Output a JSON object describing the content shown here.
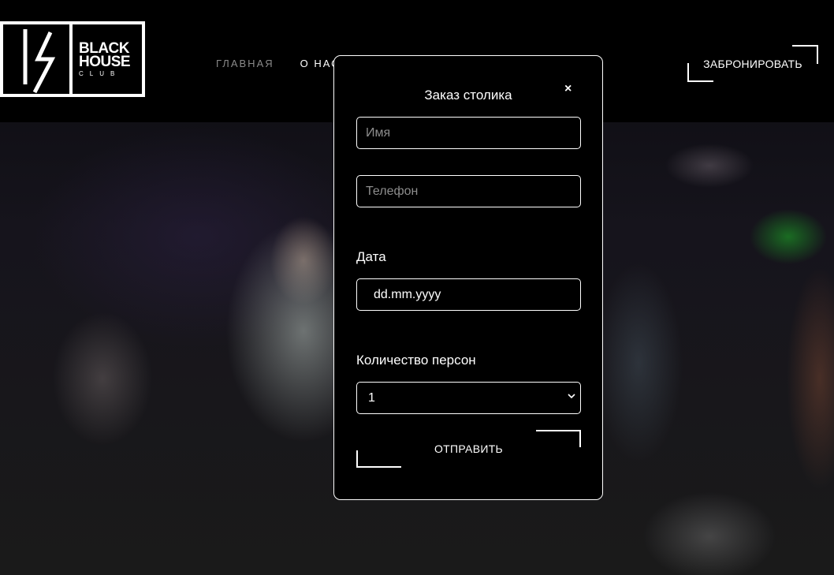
{
  "header": {
    "logo": {
      "line1": "BLACK",
      "line2": "HOUSE",
      "line3": "CLUB"
    },
    "nav": [
      {
        "label": "ГЛАВНАЯ",
        "active": false
      },
      {
        "label": "О НАС",
        "active": true
      }
    ],
    "book_button": "ЗАБРОНИРОВАТЬ"
  },
  "modal": {
    "title": "Заказ столика",
    "close": "×",
    "name_placeholder": "Имя",
    "phone_placeholder": "Телефон",
    "date_label": "Дата",
    "date_value": "dd.mm.yyyy",
    "persons_label": "Количество персон",
    "persons_value": "1",
    "submit": "ОТПРАВИТЬ"
  },
  "colors": {
    "background": "#000000",
    "text": "#ffffff",
    "muted_nav": "#8a8a8a",
    "placeholder": "#8d8d8d",
    "accent_green": "#1eb428"
  }
}
